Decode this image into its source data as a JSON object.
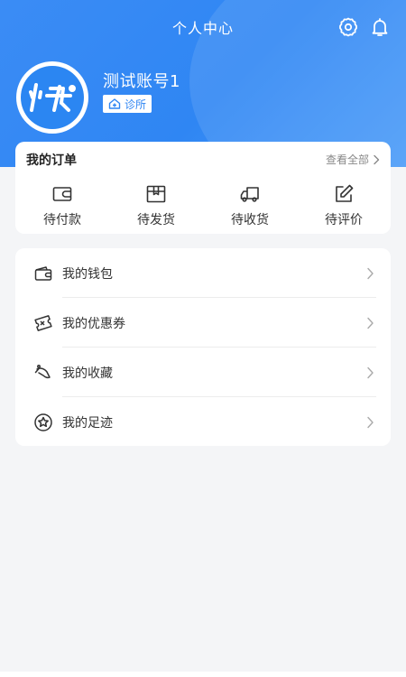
{
  "header": {
    "title": "个人中心",
    "settings_icon": "gear-icon",
    "notification_icon": "bell-icon",
    "background_color": "#2f86f3"
  },
  "profile": {
    "avatar_icon": "kuai-logo",
    "username": "测试账号1",
    "tag_icon": "clinic-house-icon",
    "tag_label": "诊所"
  },
  "orders": {
    "title": "我的订单",
    "view_all": "查看全部",
    "items": [
      {
        "label": "待付款",
        "icon": "wallet-card-icon"
      },
      {
        "label": "待发货",
        "icon": "package-box-icon"
      },
      {
        "label": "待收货",
        "icon": "delivery-truck-icon"
      },
      {
        "label": "待评价",
        "icon": "edit-review-icon"
      }
    ]
  },
  "menu": {
    "items": [
      {
        "label": "我的钱包",
        "icon": "wallet-icon"
      },
      {
        "label": "我的优惠券",
        "icon": "coupon-icon"
      },
      {
        "label": "我的收藏",
        "icon": "favorite-icon"
      },
      {
        "label": "我的足迹",
        "icon": "footprint-star-icon"
      }
    ]
  }
}
